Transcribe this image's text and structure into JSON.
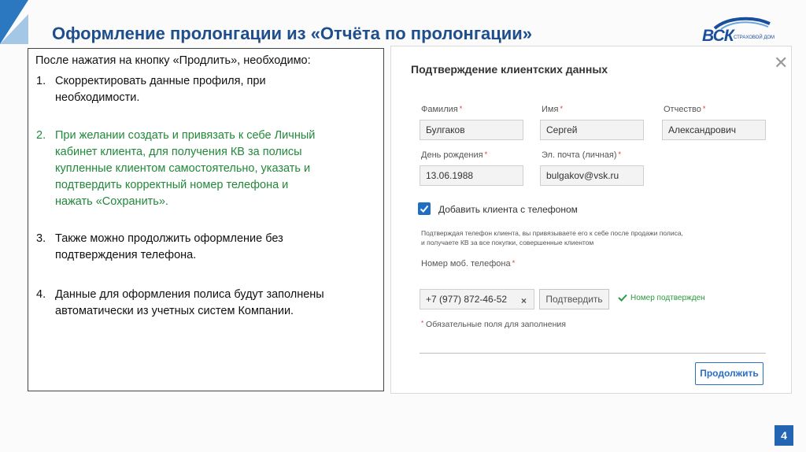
{
  "slide": {
    "title": "Оформление пролонгации из «Отчёта по пролонгации»",
    "page_number": "4",
    "accent_color": "#1f4e8c",
    "green_color": "#22893a"
  },
  "logo": {
    "text": "ВСК",
    "subtext": "СТРАХОВОЙ ДОМ"
  },
  "instructions": {
    "intro": "После нажатия на кнопку «Продлить», необходимо:",
    "items": [
      {
        "num": "1.",
        "lines": [
          "Скорректировать данные профиля, при",
          "необходимости."
        ]
      },
      {
        "num": "2.",
        "lines": [
          "При желании создать и привязать к себе Личный",
          "кабинет клиента, для получения КВ за полисы",
          "купленные клиентом самостоятельно, указать и",
          "подтвердить корректный номер телефона и",
          "нажать «Сохранить»."
        ]
      },
      {
        "num": "3.",
        "lines": [
          "Также можно продолжить оформление без",
          "подтверждения телефона."
        ]
      },
      {
        "num": "4.",
        "lines": [
          "Данные для оформления полиса будут заполнены",
          "автоматически из учетных систем Компании."
        ]
      }
    ]
  },
  "modal": {
    "title": "Подтверждение клиентских данных",
    "close_icon": "close-icon",
    "fields": {
      "last_name": {
        "label": "Фамилия",
        "value": "Булгаков"
      },
      "first_name": {
        "label": "Имя",
        "value": "Сергей"
      },
      "patronymic": {
        "label": "Отчество",
        "value": "Александрович"
      },
      "birth_date": {
        "label": "День рождения",
        "value": "13.06.1988"
      },
      "email": {
        "label": "Эл. почта (личная)",
        "value": "bulgakov@vsk.ru"
      },
      "phone": {
        "label": "Номер моб. телефона",
        "value": "+7 (977) 872-46-52"
      }
    },
    "required_mark": "*",
    "checkbox": {
      "label": "Добавить клиента с телефоном",
      "checked": true
    },
    "note_lines": [
      "Подтверждая телефон клиента, вы привязываете его к себе после продажи полиса,",
      "и получаете КВ за все покупки, совершенные клиентом"
    ],
    "phone_clear": "×",
    "confirm_button": "Подтвердить",
    "verified_text": "Номер подтвержден",
    "required_note": "Обязательные поля для заполнения",
    "continue_button": "Продолжить"
  }
}
